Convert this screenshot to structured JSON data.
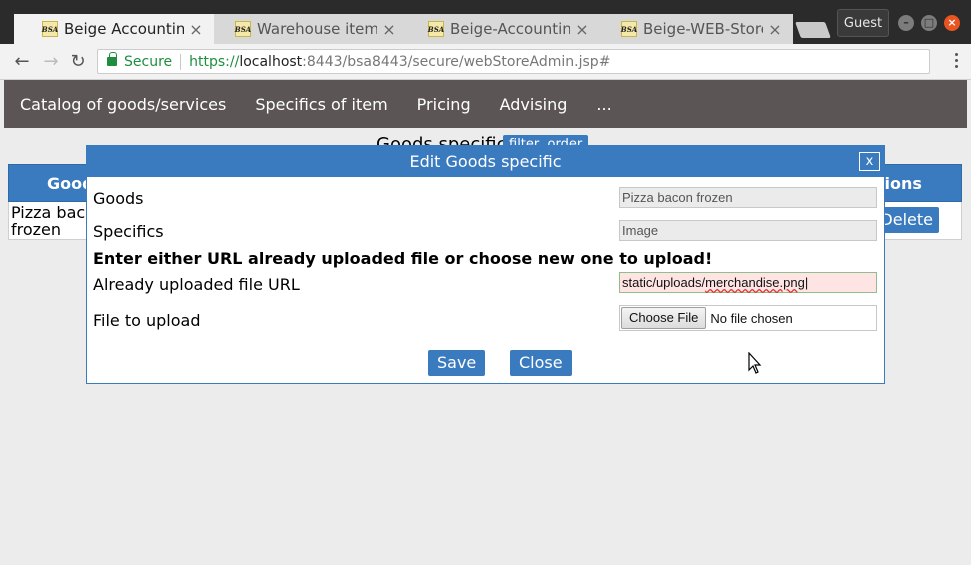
{
  "browser": {
    "tabs": [
      {
        "title": "Beige Accounting",
        "active": true,
        "favicon": "BSA"
      },
      {
        "title": "Warehouse items J",
        "active": false,
        "favicon": "BSA"
      },
      {
        "title": "Beige-Accounting",
        "active": false,
        "favicon": "BSA"
      },
      {
        "title": "Beige-WEB-Store",
        "active": false,
        "favicon": "BSA"
      }
    ],
    "profile": "Guest",
    "security_label": "Secure",
    "url_scheme": "https://",
    "url_host": "localhost",
    "url_rest": ":8443/bsa8443/secure/webStoreAdmin.jsp#"
  },
  "app_nav": {
    "items": [
      "Catalog of goods/services",
      "Specifics of item",
      "Pricing",
      "Advising",
      "..."
    ]
  },
  "list": {
    "title": "Goods specific",
    "filter_label": "filter, order",
    "columns": [
      "Goods",
      "Actions"
    ],
    "rows": [
      {
        "goods_line1": "Pizza bacon",
        "goods_line2": "frozen",
        "action": "Delete"
      }
    ]
  },
  "dialog": {
    "title": "Edit Goods specific",
    "close_x": "x",
    "goods_label": "Goods",
    "goods_value": "Pizza bacon frozen",
    "specifics_label": "Specifics",
    "specifics_value": "Image",
    "note": "Enter either URL already uploaded file or choose new one to upload!",
    "url_label": "Already uploaded file URL",
    "url_value_prefix": "static/uploads/",
    "url_value_file": "merchandise.png",
    "file_label": "File to upload",
    "choose_file": "Choose File",
    "no_file": "No file chosen",
    "save": "Save",
    "close": "Close"
  },
  "colors": {
    "accent": "#3a7abf",
    "nav_bg": "#5b5655",
    "secure_green": "#1e8e3e",
    "window_close": "#e95420"
  }
}
